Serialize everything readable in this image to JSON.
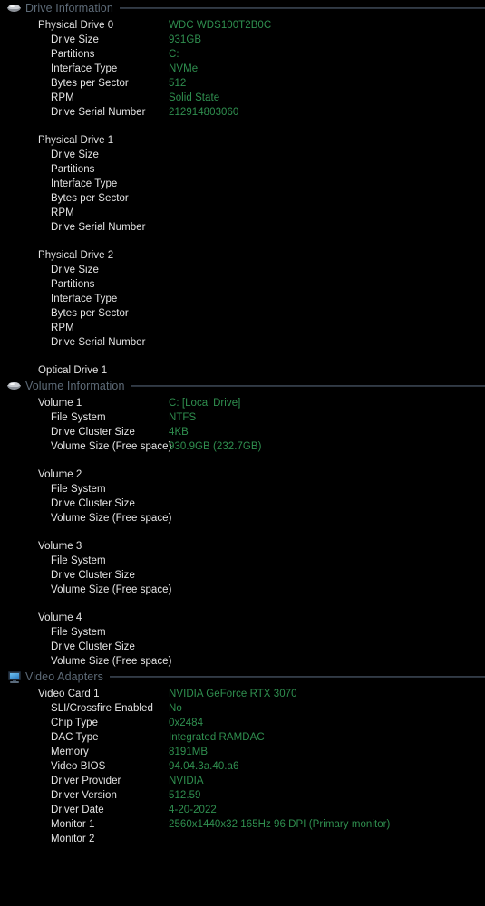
{
  "colors": {
    "background": "#000000",
    "label": "#e4e4e4",
    "value": "#2f8f4f",
    "section_title": "#5d6a77",
    "rule": "#2b333d"
  },
  "sections": [
    {
      "id": "drive-information",
      "title": "Drive Information",
      "icon": "drive-icon",
      "rows": [
        {
          "level": 1,
          "label": "Physical Drive 0",
          "value": "WDC WDS100T2B0C"
        },
        {
          "level": 2,
          "label": "Drive Size",
          "value": "931GB"
        },
        {
          "level": 2,
          "label": "Partitions",
          "value": "C:"
        },
        {
          "level": 2,
          "label": "Interface Type",
          "value": "NVMe"
        },
        {
          "level": 2,
          "label": "Bytes per Sector",
          "value": "512"
        },
        {
          "level": 2,
          "label": "RPM",
          "value": "Solid State"
        },
        {
          "level": 2,
          "label": "Drive Serial Number",
          "value": "212914803060"
        },
        {
          "spacer": true
        },
        {
          "level": 1,
          "label": "Physical Drive 1",
          "value": ""
        },
        {
          "level": 2,
          "label": "Drive Size",
          "value": ""
        },
        {
          "level": 2,
          "label": "Partitions",
          "value": ""
        },
        {
          "level": 2,
          "label": "Interface Type",
          "value": ""
        },
        {
          "level": 2,
          "label": "Bytes per Sector",
          "value": ""
        },
        {
          "level": 2,
          "label": "RPM",
          "value": ""
        },
        {
          "level": 2,
          "label": "Drive Serial Number",
          "value": ""
        },
        {
          "spacer": true
        },
        {
          "level": 1,
          "label": "Physical Drive 2",
          "value": ""
        },
        {
          "level": 2,
          "label": "Drive Size",
          "value": ""
        },
        {
          "level": 2,
          "label": "Partitions",
          "value": ""
        },
        {
          "level": 2,
          "label": "Interface Type",
          "value": ""
        },
        {
          "level": 2,
          "label": "Bytes per Sector",
          "value": ""
        },
        {
          "level": 2,
          "label": "RPM",
          "value": ""
        },
        {
          "level": 2,
          "label": "Drive Serial Number",
          "value": ""
        },
        {
          "spacer": true
        },
        {
          "level": 1,
          "label": "Optical Drive 1",
          "value": ""
        }
      ]
    },
    {
      "id": "volume-information",
      "title": "Volume Information",
      "icon": "drive-icon",
      "rows": [
        {
          "level": 1,
          "label": "Volume 1",
          "value": "C:  [Local Drive]"
        },
        {
          "level": 2,
          "label": "File System",
          "value": "NTFS"
        },
        {
          "level": 2,
          "label": "Drive Cluster Size",
          "value": "4KB"
        },
        {
          "level": 2,
          "label": "Volume Size (Free space)",
          "value": "930.9GB (232.7GB)"
        },
        {
          "spacer": true
        },
        {
          "level": 1,
          "label": "Volume 2",
          "value": ""
        },
        {
          "level": 2,
          "label": "File System",
          "value": ""
        },
        {
          "level": 2,
          "label": "Drive Cluster Size",
          "value": ""
        },
        {
          "level": 2,
          "label": "Volume Size (Free space)",
          "value": ""
        },
        {
          "spacer": true
        },
        {
          "level": 1,
          "label": "Volume 3",
          "value": ""
        },
        {
          "level": 2,
          "label": "File System",
          "value": ""
        },
        {
          "level": 2,
          "label": "Drive Cluster Size",
          "value": ""
        },
        {
          "level": 2,
          "label": "Volume Size (Free space)",
          "value": ""
        },
        {
          "spacer": true
        },
        {
          "level": 1,
          "label": "Volume 4",
          "value": ""
        },
        {
          "level": 2,
          "label": "File System",
          "value": ""
        },
        {
          "level": 2,
          "label": "Drive Cluster Size",
          "value": ""
        },
        {
          "level": 2,
          "label": "Volume Size (Free space)",
          "value": ""
        }
      ]
    },
    {
      "id": "video-adapters",
      "title": "Video Adapters",
      "icon": "monitor-icon",
      "rows": [
        {
          "level": 1,
          "label": "Video Card 1",
          "value": "NVIDIA GeForce RTX 3070"
        },
        {
          "level": 2,
          "label": "SLI/Crossfire Enabled",
          "value": "No"
        },
        {
          "level": 2,
          "label": "Chip Type",
          "value": "0x2484"
        },
        {
          "level": 2,
          "label": "DAC Type",
          "value": "Integrated RAMDAC"
        },
        {
          "level": 2,
          "label": "Memory",
          "value": "8191MB"
        },
        {
          "level": 2,
          "label": "Video BIOS",
          "value": "94.04.3a.40.a6"
        },
        {
          "level": 2,
          "label": "Driver Provider",
          "value": "NVIDIA"
        },
        {
          "level": 2,
          "label": "Driver Version",
          "value": "512.59"
        },
        {
          "level": 2,
          "label": "Driver Date",
          "value": "4-20-2022"
        },
        {
          "level": 2,
          "label": "Monitor 1",
          "value": "2560x1440x32 165Hz 96 DPI (Primary monitor)"
        },
        {
          "level": 2,
          "label": "Monitor 2",
          "value": ""
        }
      ]
    }
  ]
}
